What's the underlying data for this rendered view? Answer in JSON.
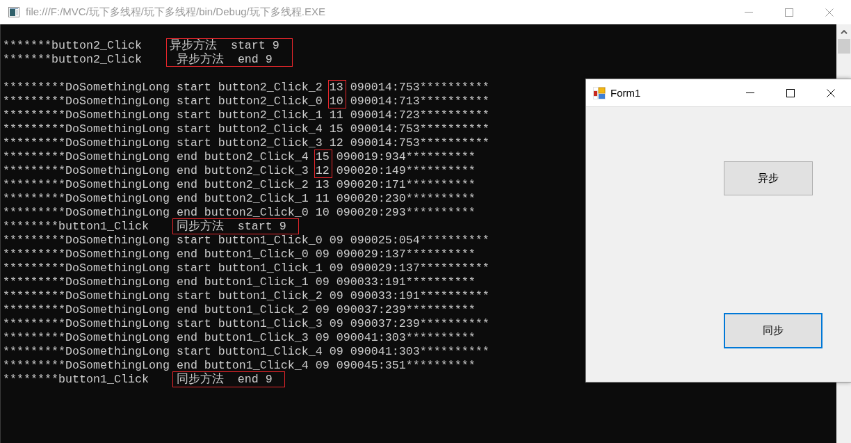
{
  "console_window": {
    "title": "file:///F:/MVC/玩下多线程/玩下多线程/bin/Debug/玩下多线程.EXE",
    "active": false,
    "blocks": [
      {
        "lines": [
          {
            "kind": "event",
            "text": "*******button2_Click",
            "boxed": "异步方法  start 9"
          },
          {
            "kind": "event",
            "text": "*******button2_Click",
            "boxed": " 异步方法  end 9"
          }
        ]
      },
      {
        "lines": [
          {
            "kind": "log",
            "text": "*********DoSomethingLong start button2_Click_2",
            "boxed": "13",
            "rest": "090014:753**********"
          },
          {
            "kind": "log",
            "text": "*********DoSomethingLong start button2_Click_0",
            "boxed": "10",
            "rest": "090014:713**********"
          },
          {
            "kind": "log",
            "text": "*********DoSomethingLong start button2_Click_1 11 090014:723**********"
          },
          {
            "kind": "log",
            "text": "*********DoSomethingLong start button2_Click_4 15 090014:753**********"
          },
          {
            "kind": "log",
            "text": "*********DoSomethingLong start button2_Click_3 12 090014:753**********"
          },
          {
            "kind": "log",
            "text": "*********DoSomethingLong end button2_Click_4",
            "boxed": "15",
            "rest": "090019:934**********"
          },
          {
            "kind": "log",
            "text": "*********DoSomethingLong end button2_Click_3",
            "boxed": "12",
            "rest": "090020:149**********"
          },
          {
            "kind": "log",
            "text": "*********DoSomethingLong end button2_Click_2 13 090020:171**********"
          },
          {
            "kind": "log",
            "text": "*********DoSomethingLong end button2_Click_1 11 090020:230**********"
          },
          {
            "kind": "log",
            "text": "*********DoSomethingLong end button2_Click_0 10 090020:293**********"
          },
          {
            "kind": "event",
            "text": "********button1_Click",
            "boxed": "同步方法  start 9"
          },
          {
            "kind": "log",
            "text": "*********DoSomethingLong start button1_Click_0 09 090025:054**********"
          },
          {
            "kind": "log",
            "text": "*********DoSomethingLong end button1_Click_0 09 090029:137**********"
          },
          {
            "kind": "log",
            "text": "*********DoSomethingLong start button1_Click_1 09 090029:137**********"
          },
          {
            "kind": "log",
            "text": "*********DoSomethingLong end button1_Click_1 09 090033:191**********"
          },
          {
            "kind": "log",
            "text": "*********DoSomethingLong start button1_Click_2 09 090033:191**********"
          },
          {
            "kind": "log",
            "text": "*********DoSomethingLong end button1_Click_2 09 090037:239**********"
          },
          {
            "kind": "log",
            "text": "*********DoSomethingLong start button1_Click_3 09 090037:239**********"
          },
          {
            "kind": "log",
            "text": "*********DoSomethingLong end button1_Click_3 09 090041:303**********"
          },
          {
            "kind": "log",
            "text": "*********DoSomethingLong start button1_Click_4 09 090041:303**********"
          },
          {
            "kind": "log",
            "text": "*********DoSomethingLong end button1_Click_4 09 090045:351**********"
          },
          {
            "kind": "event",
            "text": "********button1_Click",
            "boxed": "同步方法  end 9"
          }
        ]
      }
    ]
  },
  "form_window": {
    "title": "Form1",
    "active": true,
    "buttons": [
      {
        "label": "异步",
        "focused": false
      },
      {
        "label": "同步",
        "focused": true
      }
    ]
  }
}
